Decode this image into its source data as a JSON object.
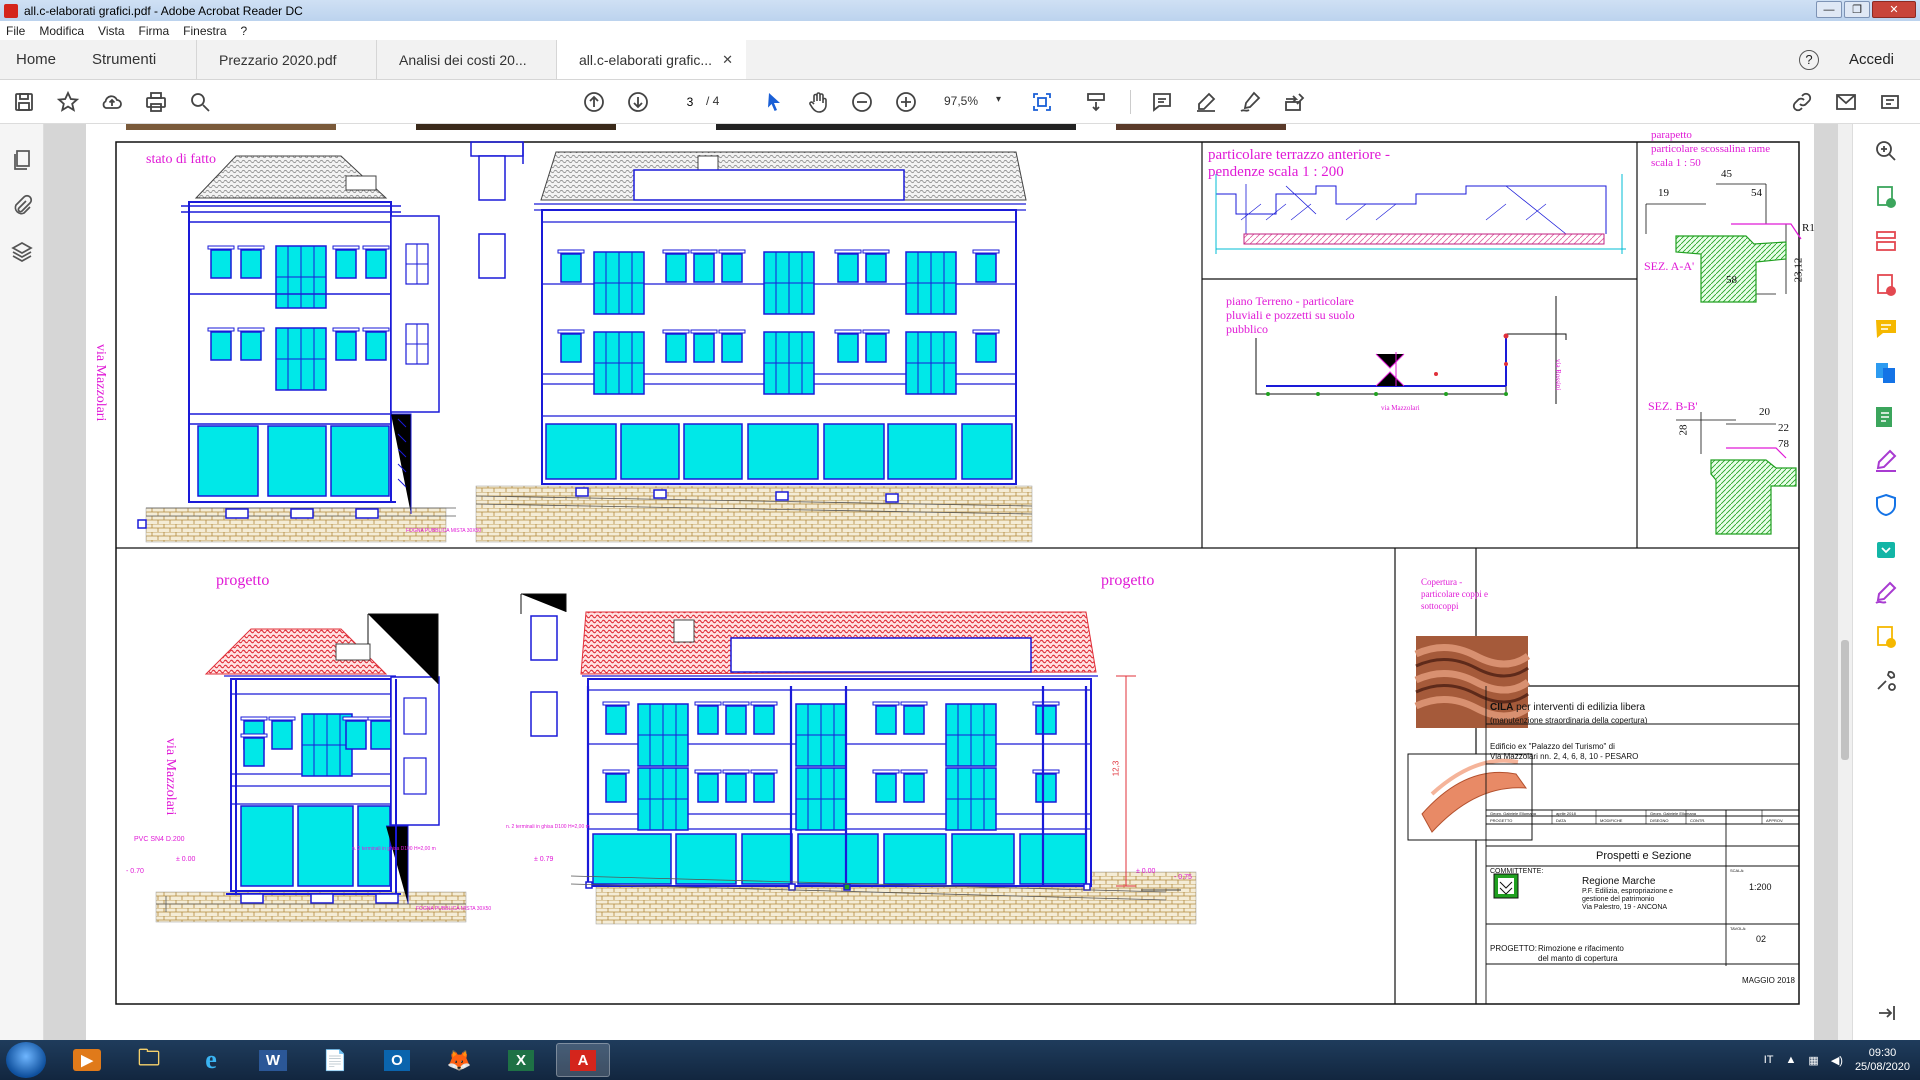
{
  "window": {
    "title": "all.c-elaborati grafici.pdf - Adobe Acrobat Reader DC",
    "controls": [
      "—",
      "❐",
      "✕"
    ]
  },
  "menu": [
    "File",
    "Modifica",
    "Vista",
    "Firma",
    "Finestra",
    "?"
  ],
  "tabs": {
    "home": "Home",
    "tools": "Strumenti",
    "docs": [
      {
        "label": "Prezzario 2020.pdf"
      },
      {
        "label": "Analisi dei costi 20..."
      },
      {
        "label": "all.c-elaborati grafic...",
        "active": true
      }
    ],
    "close": "✕",
    "help": "?",
    "signin": "Accedi"
  },
  "toolbar": {
    "page_current": "3",
    "page_total": "/  4",
    "zoom": "97,5%",
    "zoom_arrow": "▾"
  },
  "drawing": {
    "top_left_label": "stato di fatto",
    "street": "via Mazzolari",
    "fogna_top": "FOGNA PUBBLICA MISTA 30X50",
    "terrace_title": "particolare terrazzo anteriore -",
    "terrace_sub": "pendenze  scala 1 : 200",
    "ground_1": "piano Terreno - particolare",
    "ground_2": "pluviali e pozzetti su suolo",
    "ground_3": "pubblico",
    "plan_street": "via Mazzolari",
    "plan_side": "via Rossini",
    "parapet_1": "parapetto",
    "parapet_2": "particolare scossalina rame",
    "parapet_3": "scala 1 : 50",
    "sez_a": "SEZ. A-A'",
    "sez_b": "SEZ. B-B'",
    "dims_a": [
      "45",
      "19",
      "54",
      "R1",
      "58",
      "23,12"
    ],
    "dims_b": [
      "20",
      "28",
      "22",
      "78"
    ],
    "progetto": "progetto",
    "pvc": "PVC SN4 D.200",
    "lvl_000": "± 0.00",
    "lvl_070": "- 0.70",
    "lvl_079": "± 0.79",
    "lvl_075": "- 0.75",
    "terminali_1": "n. 2 terminali in ghisa D100 H=2,00 m",
    "terminali_2": "n. 2 terminali in ghisa D100 H=2,00 m",
    "fogna_bottom": "FOGNA PUBBLICA MISTA 30X50",
    "height_dim": "12,3",
    "copertura_1": "Copertura -",
    "copertura_2": "particolare  coppi e",
    "copertura_3": "sottocoppi"
  },
  "cartouche": {
    "cila_title": "CILA",
    "cila_rest": " per interventi di edilizia libera",
    "cila_sub": "(manutenzione straordinaria della copertura)",
    "edificio_1": "Edificio ex \"Palazzo del Turismo\" di",
    "edificio_2": "Via Mazzolari nn. 2, 4, 6, 8, 10 - PESARO",
    "rev_cells": [
      "Geom. Gabriele Ellomana",
      "aprile 2018",
      "",
      "Geom. Gabriele Ellomana",
      "",
      ""
    ],
    "rev_heads": [
      "PROGETTO",
      "DATA",
      "MODIFICHE",
      "DISEGNO",
      "CONTR.",
      "APPROV."
    ],
    "sheet_title": "Prospetti e Sezione",
    "committente_label": "COMMITTENTE:",
    "committente_1": "Regione Marche",
    "committente_2": "P.F. Edilizia, espropriazione e",
    "committente_3": "gestione del patrimonio",
    "committente_4": "Via Palestro, 19 - ANCONA",
    "scala_label": "SCALA:",
    "scala": "1:200",
    "tavola_label": "TAVOLA:",
    "tavola": "02",
    "progetto_label": "PROGETTO:",
    "progetto_1": "Rimozione e rifacimento",
    "progetto_2": "del manto di copertura",
    "date": "MAGGIO 2018"
  },
  "taskbar": {
    "apps": [
      "▶",
      "🗀",
      "e",
      "W",
      "📄",
      "O",
      "🦊",
      "X",
      "A"
    ],
    "lang": "IT",
    "time": "09:30",
    "date": "25/08/2020"
  },
  "colors": {
    "accent": "#1473e6",
    "drawing_line": "#1a1ad8",
    "glass": "#00e8e8",
    "roof": "#e0303a",
    "magenta": "#e01ad6"
  }
}
